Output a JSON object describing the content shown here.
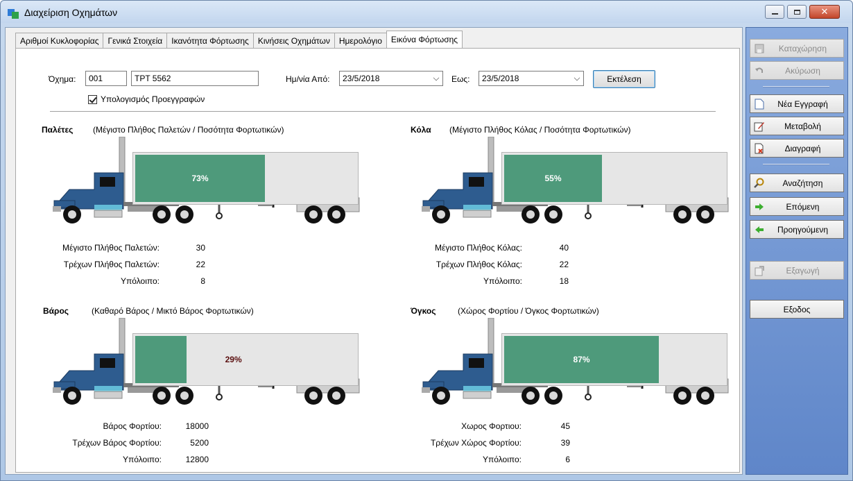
{
  "window": {
    "title": "Διαχείριση Οχημάτων"
  },
  "tabs": [
    {
      "label": "Αριθμοί Κυκλοφορίας"
    },
    {
      "label": "Γενικά Στοιχεία"
    },
    {
      "label": "Ικανότητα Φόρτωσης"
    },
    {
      "label": "Κινήσεις Οχημάτων"
    },
    {
      "label": "Ημερολόγιο"
    },
    {
      "label": "Εικόνα Φόρτωσης",
      "active": true
    }
  ],
  "filters": {
    "vehicle_label": "Όχημα:",
    "vehicle_code": "001",
    "vehicle_plate": "ΤΡΤ 5562",
    "date_from_label": "Ημ/νία Από:",
    "date_from": "23/5/2018",
    "date_to_label": "Εως:",
    "date_to": "23/5/2018",
    "execute_label": "Εκτέλεση",
    "precalc_label": "Υπολογισμός Προεγγραφών",
    "precalc_checked": true
  },
  "panels": [
    {
      "id": "pallets",
      "title": "Παλέτες",
      "subtitle": "(Μέγιστο Πλήθος Παλετών / Ποσότητα Φορτωτικών)",
      "percent": 0.73,
      "percent_label": "73%",
      "rows": [
        {
          "label": "Μέγιστο Πλήθος Παλετών:",
          "value": "30"
        },
        {
          "label": "Τρέχων Πλήθος Παλετών:",
          "value": "22"
        },
        {
          "label": "Υπόλοιπο:",
          "value": "8"
        }
      ]
    },
    {
      "id": "packages",
      "title": "Κόλα",
      "subtitle": "(Μέγιστο Πλήθος Κόλας / Ποσότητα Φορτωτικών)",
      "percent": 0.55,
      "percent_label": "55%",
      "rows": [
        {
          "label": "Μέγιστο Πλήθος Κόλας:",
          "value": "40"
        },
        {
          "label": "Τρέχων Πλήθος Κόλας:",
          "value": "22"
        },
        {
          "label": "Υπόλοιπο:",
          "value": "18"
        }
      ]
    },
    {
      "id": "weight",
      "title": "Βάρος",
      "subtitle": "(Καθαρό Βάρος / Μικτό Βάρος Φορτωτικών)",
      "percent": 0.29,
      "percent_label": "29%",
      "rows": [
        {
          "label": "Βάρος Φορτίου:",
          "value": "18000"
        },
        {
          "label": "Τρέχων  Βάρος Φορτίου:",
          "value": "5200"
        },
        {
          "label": "Υπόλοιπο:",
          "value": "12800"
        }
      ]
    },
    {
      "id": "volume",
      "title": "Όγκος",
      "subtitle": "(Χώρος Φορτίου / Όγκος Φορτωτικών)",
      "percent": 0.87,
      "percent_label": "87%",
      "rows": [
        {
          "label": "Χωρος Φορτιου:",
          "value": "45"
        },
        {
          "label": "Τρέχων Χώρος Φορτίου:",
          "value": "39"
        },
        {
          "label": "Υπόλοιπο:",
          "value": "6"
        }
      ]
    }
  ],
  "sidebar": {
    "save": "Καταχώρηση",
    "cancel": "Ακύρωση",
    "new": "Νέα Εγγραφή",
    "edit": "Μεταβολή",
    "delete": "Διαγραφή",
    "search": "Αναζήτηση",
    "next": "Επόμενη",
    "previous": "Προηγούμενη",
    "export": "Εξαγωγή",
    "exit": "Εξοδος"
  },
  "colors": {
    "fill": "#4e9a7b",
    "trailer": "#e6e6e6",
    "truck_cab": "#2e5c8f"
  }
}
